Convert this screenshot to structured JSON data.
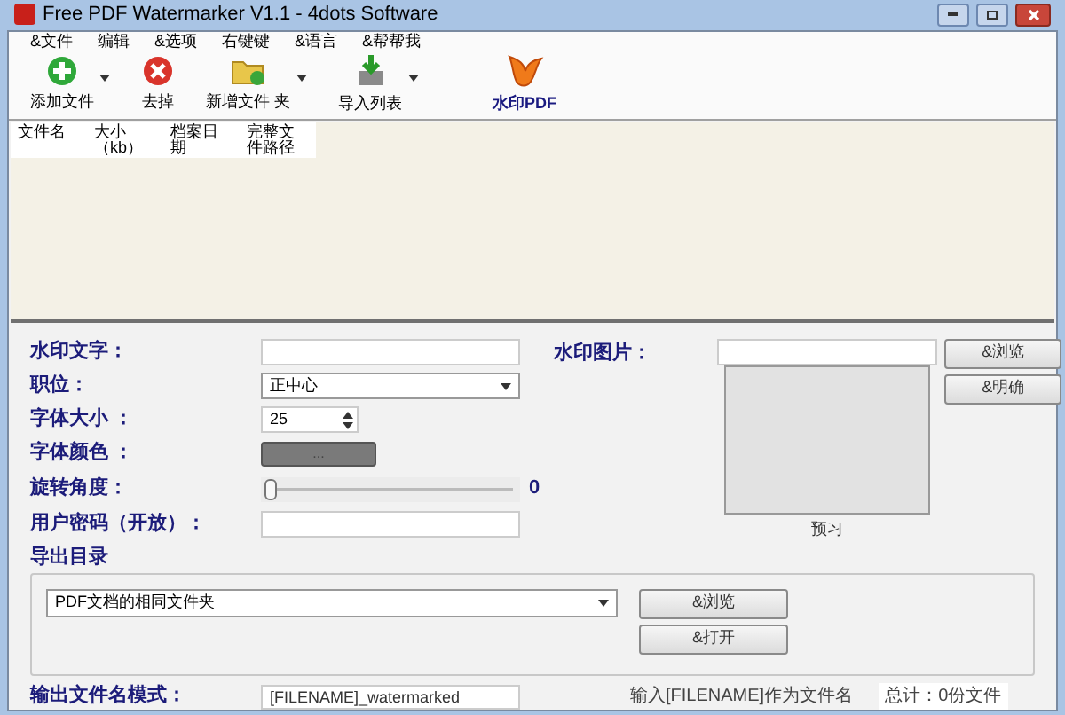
{
  "window": {
    "title": "Free PDF Watermarker V1.1 - 4dots Software"
  },
  "menu": [
    "&文件",
    "编辑",
    "&选项",
    "右键键",
    "&语言",
    "&帮帮我"
  ],
  "toolbar": [
    {
      "kind": "add",
      "label": "添加文件",
      "dropdown": true
    },
    {
      "kind": "remove",
      "label": "去掉",
      "dropdown": false
    },
    {
      "kind": "folder",
      "label": "新增文件 夹",
      "dropdown": true
    },
    {
      "kind": "import",
      "label": "导入列表",
      "dropdown": true
    },
    {
      "kind": "watermark",
      "label": "水印PDF",
      "dropdown": false
    }
  ],
  "table": {
    "columns": [
      "文件名",
      "大小（kb）",
      "档案日期",
      "完整文件路径"
    ]
  },
  "form": {
    "watermark_text": {
      "label": "水印文字："
    },
    "position": {
      "label": "职位：",
      "value": "正中心"
    },
    "font_size": {
      "label": "字体大小 ：",
      "value": "25"
    },
    "font_color": {
      "label": "字体颜色 ：",
      "button": "...",
      "color": "#7a7a7a"
    },
    "rotation": {
      "label": "旋转角度：",
      "level": 0,
      "reading": "0"
    },
    "user_password": {
      "label": "用户密码（开放）："
    },
    "watermark_image": {
      "label": "水印图片：",
      "buttons": [
        "&浏览",
        "&明确"
      ],
      "preview_label": "预习"
    }
  },
  "output": {
    "label": "导出目录",
    "folder": "PDF文档的相同文件夹",
    "buttons": [
      "&浏览",
      "&打开"
    ]
  },
  "filename_pattern": {
    "label": "输出文件名模式：",
    "value": "[FILENAME]_watermarked",
    "hint": "输入[FILENAME]作为文件名",
    "total": "总计：0份文件"
  }
}
